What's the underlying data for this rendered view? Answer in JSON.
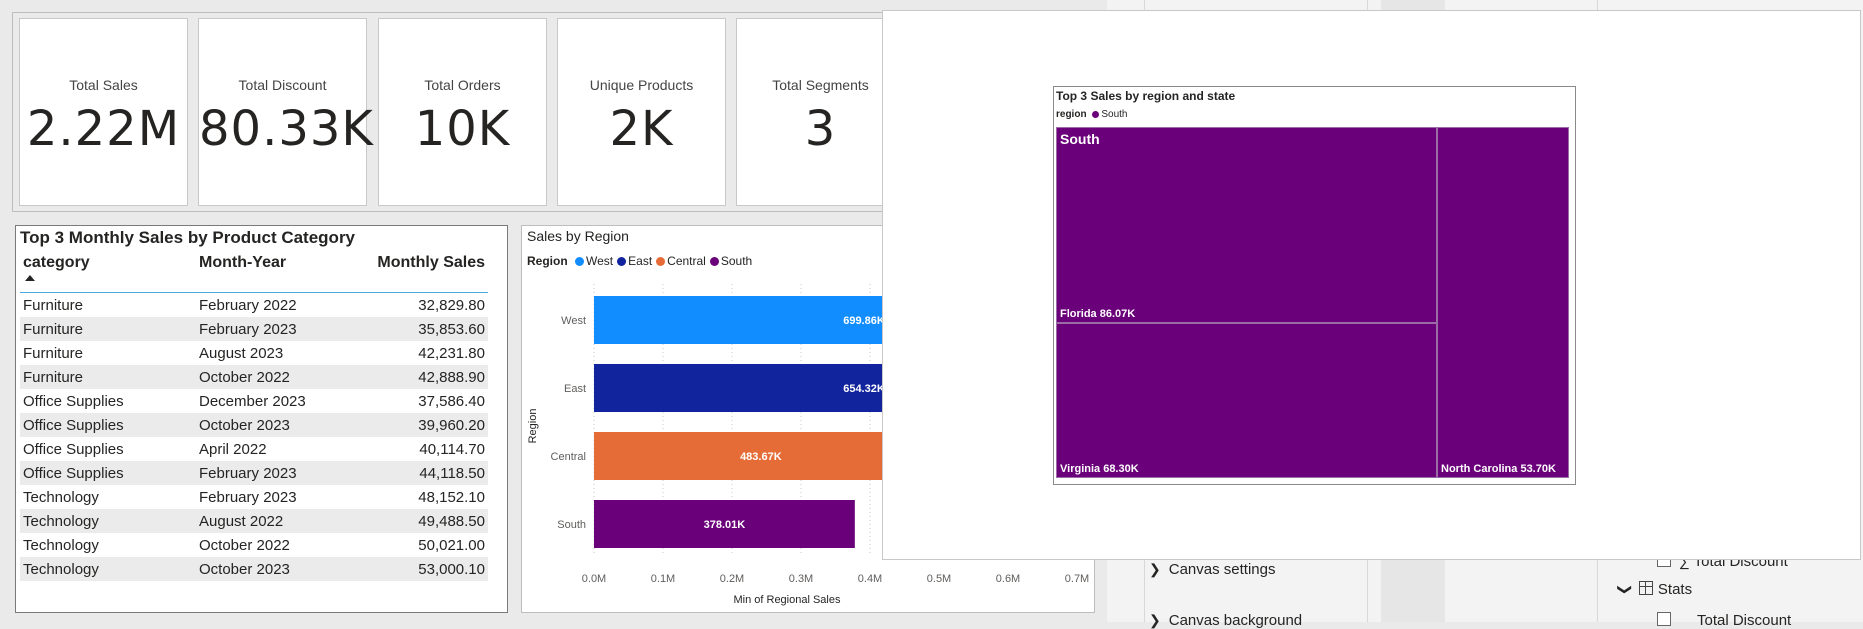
{
  "kpi_cards": [
    {
      "label": "Total Sales",
      "value": "2.22M"
    },
    {
      "label": "Total Discount",
      "value": "80.33K"
    },
    {
      "label": "Total Orders",
      "value": "10K"
    },
    {
      "label": "Unique Products",
      "value": "2K"
    },
    {
      "label": "Total Segments",
      "value": "3"
    }
  ],
  "table": {
    "title": "Top 3 Monthly Sales by Product Category",
    "columns": [
      "category",
      "Month-Year",
      "Monthly Sales"
    ],
    "rows": [
      [
        "Furniture",
        "February 2022",
        "32,829.80"
      ],
      [
        "Furniture",
        "February 2023",
        "35,853.60"
      ],
      [
        "Furniture",
        "August 2023",
        "42,231.80"
      ],
      [
        "Furniture",
        "October 2022",
        "42,888.90"
      ],
      [
        "Office Supplies",
        "December 2023",
        "37,586.40"
      ],
      [
        "Office Supplies",
        "October 2023",
        "39,960.20"
      ],
      [
        "Office Supplies",
        "April 2022",
        "40,114.70"
      ],
      [
        "Office Supplies",
        "February 2023",
        "44,118.50"
      ],
      [
        "Technology",
        "February 2023",
        "48,152.10"
      ],
      [
        "Technology",
        "August 2022",
        "49,488.50"
      ],
      [
        "Technology",
        "October 2022",
        "50,021.00"
      ],
      [
        "Technology",
        "October 2023",
        "53,000.10"
      ]
    ]
  },
  "bar_chart": {
    "title": "Sales by Region",
    "legend_title": "Region",
    "legend": [
      {
        "name": "West",
        "color": "#118dff"
      },
      {
        "name": "East",
        "color": "#12239e"
      },
      {
        "name": "Central",
        "color": "#e66c37"
      },
      {
        "name": "South",
        "color": "#6b007b"
      }
    ],
    "ylabel": "Region",
    "xlabel": "Min of Regional Sales",
    "x_ticks": [
      "0.0M",
      "0.1M",
      "0.2M",
      "0.3M",
      "0.4M",
      "0.5M",
      "0.6M",
      "0.7M"
    ]
  },
  "chart_data": [
    {
      "type": "bar",
      "title": "Sales by Region",
      "orientation": "horizontal",
      "categories": [
        "West",
        "East",
        "Central",
        "South"
      ],
      "values": [
        699.86,
        654.32,
        483.67,
        378.01
      ],
      "value_unit": "K",
      "data_labels": [
        "699.86K",
        "654.32K",
        "483.67K",
        "378.01K"
      ],
      "colors": [
        "#118dff",
        "#12239e",
        "#e66c37",
        "#6b007b"
      ],
      "xlabel": "Min of Regional Sales",
      "ylabel": "Region",
      "xlim": [
        0,
        700
      ],
      "grid": true,
      "legend_position": "top-left"
    },
    {
      "type": "treemap",
      "title": "Top 3 Sales by region and state",
      "legend_title": "region",
      "legend": [
        {
          "name": "South",
          "color": "#6b007b"
        }
      ],
      "group": "South",
      "items": [
        {
          "label": "Florida 86.07K",
          "name": "Florida",
          "value": 86.07
        },
        {
          "label": "Virginia 68.30K",
          "name": "Virginia",
          "value": 68.3
        },
        {
          "label": "North Carolina 53.70K",
          "name": "North Carolina",
          "value": 53.7
        }
      ],
      "color": "#6b007b"
    }
  ],
  "right_pane": {
    "format_items": [
      "Canvas settings",
      "Canvas background"
    ],
    "data_items": [
      {
        "label": "Total Discount",
        "type": "measure"
      },
      {
        "label": "Stats",
        "type": "table"
      },
      {
        "label": "Total Discount",
        "type": "field"
      }
    ],
    "sigma_symbol": "∑"
  }
}
